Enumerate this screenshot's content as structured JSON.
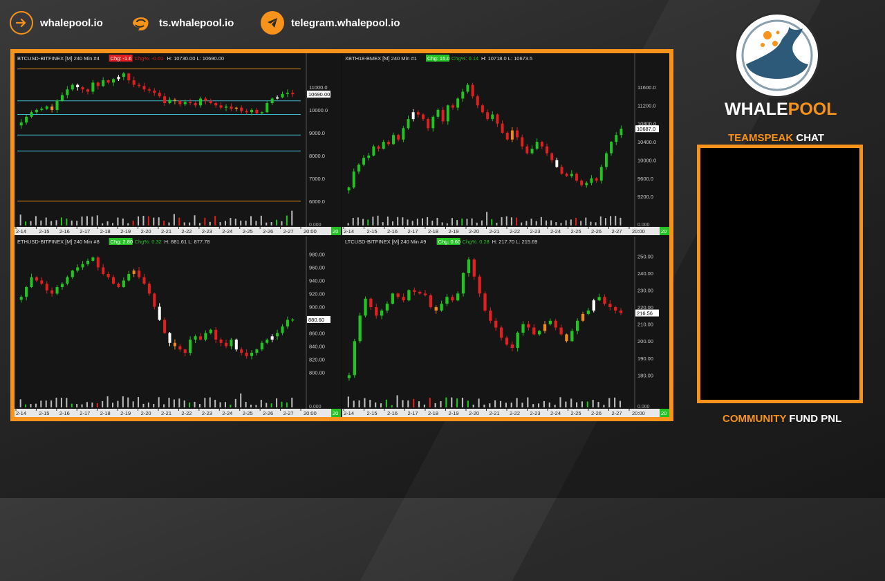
{
  "links": [
    {
      "label": "whalepool.io",
      "icon": "arrow-right-circle-icon"
    },
    {
      "label": "ts.whalepool.io",
      "icon": "teamspeak-icon"
    },
    {
      "label": "telegram.whalepool.io",
      "icon": "telegram-icon"
    }
  ],
  "brand": {
    "part1": "WHALE",
    "part2": "POOL"
  },
  "teamspeak": {
    "part1": "TEAMSPEAK",
    "part2": "CHAT"
  },
  "community": {
    "part1": "COMMUNITY",
    "part2": "FUND PNL"
  },
  "colors": {
    "accent": "#f7931a",
    "up": "#22c322",
    "down": "#e02020",
    "hline": "#3fb8c8"
  },
  "charts": [
    {
      "symbol": "BTCUSD-BITFINEX [M]",
      "interval": "240 Min",
      "num": "#4",
      "badge": "Chg: -1.6",
      "badge_color": "#e02020",
      "chg": "Chg%: -0.01",
      "chg_color": "#e02020",
      "hl": "H: 10730.00  L: 10690.00",
      "yticks": [
        "11000.0",
        "10000.0",
        "9000.0",
        "8000.0",
        "7000.0",
        "6000.0"
      ],
      "yzero": "0.000",
      "last": "10690.00",
      "xticks": [
        "2-14",
        "2-15",
        "2-16",
        "2-17",
        "2-18",
        "2-19",
        "2-20",
        "2-21",
        "2-22",
        "2-23",
        "2-24",
        "2-25",
        "2-26",
        "2-27",
        "20:00"
      ],
      "corner": "20",
      "ymin": 5600,
      "ymax": 12000
    },
    {
      "symbol": "XBTH18-BMEX [M]",
      "interval": "240 Min",
      "num": "#1",
      "badge": "Chg: 15.0",
      "badge_color": "#22c322",
      "chg": "Chg%: 0.14",
      "chg_color": "#22c322",
      "hl": "H: 10718.0  L: 10673.5",
      "yticks": [
        "11600.0",
        "11200.0",
        "10800.0",
        "10400.0",
        "10000.0",
        "9600.0",
        "9200.0"
      ],
      "yzero": "0.000",
      "last": "10687.0",
      "xticks": [
        "2-14",
        "2-15",
        "2-16",
        "2-17",
        "2-18",
        "2-19",
        "2-20",
        "2-21",
        "2-22",
        "2-23",
        "2-24",
        "2-25",
        "2-26",
        "2-27",
        "20:00"
      ],
      "corner": "20",
      "ymin": 8900,
      "ymax": 12100
    },
    {
      "symbol": "ETHUSD-BITFINEX [M]",
      "interval": "240 Min",
      "num": "#8",
      "badge": "Chg: 2.80",
      "badge_color": "#22c322",
      "chg": "Chg%: 0.32",
      "chg_color": "#22c322",
      "hl": "H: 881.61  L: 877.78",
      "yticks": [
        "980.00",
        "960.00",
        "940.00",
        "920.00",
        "900.00",
        "880.00",
        "860.00",
        "840.00",
        "820.00",
        "800.00"
      ],
      "yzero": "0.000",
      "last": "880.60",
      "xticks": [
        "2-14",
        "2-15",
        "2-16",
        "2-17",
        "2-18",
        "2-19",
        "2-20",
        "2-21",
        "2-22",
        "2-23",
        "2-24",
        "2-25",
        "2-26",
        "2-27",
        "20:00"
      ],
      "corner": "20",
      "ymin": 770,
      "ymax": 990
    },
    {
      "symbol": "LTCUSD-BITFINEX [M]",
      "interval": "240 Min",
      "num": "#9",
      "badge": "Chg: 0.60",
      "badge_color": "#22c322",
      "chg": "Chg%: 0.28",
      "chg_color": "#22c322",
      "hl": "H: 217.70  L: 215.69",
      "yticks": [
        "250.00",
        "240.00",
        "230.00",
        "220.00",
        "210.00",
        "200.00",
        "190.00",
        "180.00"
      ],
      "yzero": "0.000",
      "last": "216.56",
      "xticks": [
        "2-14",
        "2-15",
        "2-16",
        "2-17",
        "2-18",
        "2-19",
        "2-20",
        "2-21",
        "2-22",
        "2-23",
        "2-24",
        "2-25",
        "2-26",
        "2-27",
        "20:00"
      ],
      "corner": "20",
      "ymin": 170,
      "ymax": 255
    }
  ],
  "chart_data": [
    {
      "type": "candlestick",
      "title": "BTCUSD-BITFINEX [M] 240 Min",
      "closes": [
        9450,
        9700,
        9900,
        10000,
        10050,
        10150,
        10000,
        10400,
        10650,
        10900,
        11100,
        11000,
        10900,
        10800,
        11200,
        11050,
        11300,
        11200,
        11350,
        11450,
        11600,
        11300,
        11100,
        11050,
        10900,
        10850,
        10750,
        10600,
        10300,
        10450,
        10400,
        10250,
        10350,
        10300,
        10200,
        10500,
        10400,
        10300,
        10200,
        10100,
        10150,
        10050,
        10100,
        9950,
        9900,
        10000,
        9850,
        9900,
        10300,
        10500,
        10550,
        10700,
        10750,
        10690
      ],
      "hlines": [
        11800,
        10400,
        9800,
        8900,
        8200,
        6000
      ]
    },
    {
      "type": "candlestick",
      "title": "XBTH18-BMEX [M] 240 Min",
      "closes": [
        9400,
        9750,
        9900,
        10050,
        10100,
        10300,
        10250,
        10400,
        10350,
        10550,
        10450,
        10700,
        10900,
        11050,
        11000,
        10900,
        10700,
        10950,
        11100,
        10850,
        11200,
        11150,
        11350,
        11500,
        11650,
        11400,
        11200,
        11050,
        10900,
        11000,
        10800,
        10600,
        10450,
        10650,
        10500,
        10300,
        10150,
        10250,
        10400,
        10300,
        10150,
        10000,
        9850,
        9700,
        9650,
        9700,
        9550,
        9450,
        9500,
        9600,
        9550,
        9850,
        10150,
        10400,
        10550,
        10687
      ]
    },
    {
      "type": "candlestick",
      "title": "ETHUSD-BITFINEX [M] 240 Min",
      "closes": [
        915,
        930,
        945,
        940,
        935,
        925,
        920,
        930,
        935,
        945,
        955,
        960,
        965,
        970,
        975,
        960,
        950,
        945,
        935,
        930,
        940,
        950,
        955,
        945,
        935,
        920,
        900,
        880,
        860,
        845,
        840,
        835,
        830,
        850,
        855,
        850,
        860,
        865,
        850,
        845,
        840,
        850,
        835,
        830,
        825,
        830,
        835,
        845,
        850,
        855,
        860,
        870,
        880,
        880.6
      ]
    },
    {
      "type": "candlestick",
      "title": "LTCUSD-BITFINEX [M] 240 Min",
      "closes": [
        180,
        200,
        215,
        225,
        220,
        215,
        218,
        222,
        228,
        226,
        224,
        230,
        229,
        228,
        227,
        220,
        218,
        222,
        226,
        224,
        228,
        240,
        248,
        238,
        228,
        218,
        212,
        208,
        202,
        198,
        196,
        205,
        210,
        208,
        204,
        206,
        210,
        212,
        208,
        204,
        200,
        206,
        212,
        216,
        218,
        224,
        226,
        222,
        220,
        218,
        216.56
      ]
    }
  ]
}
